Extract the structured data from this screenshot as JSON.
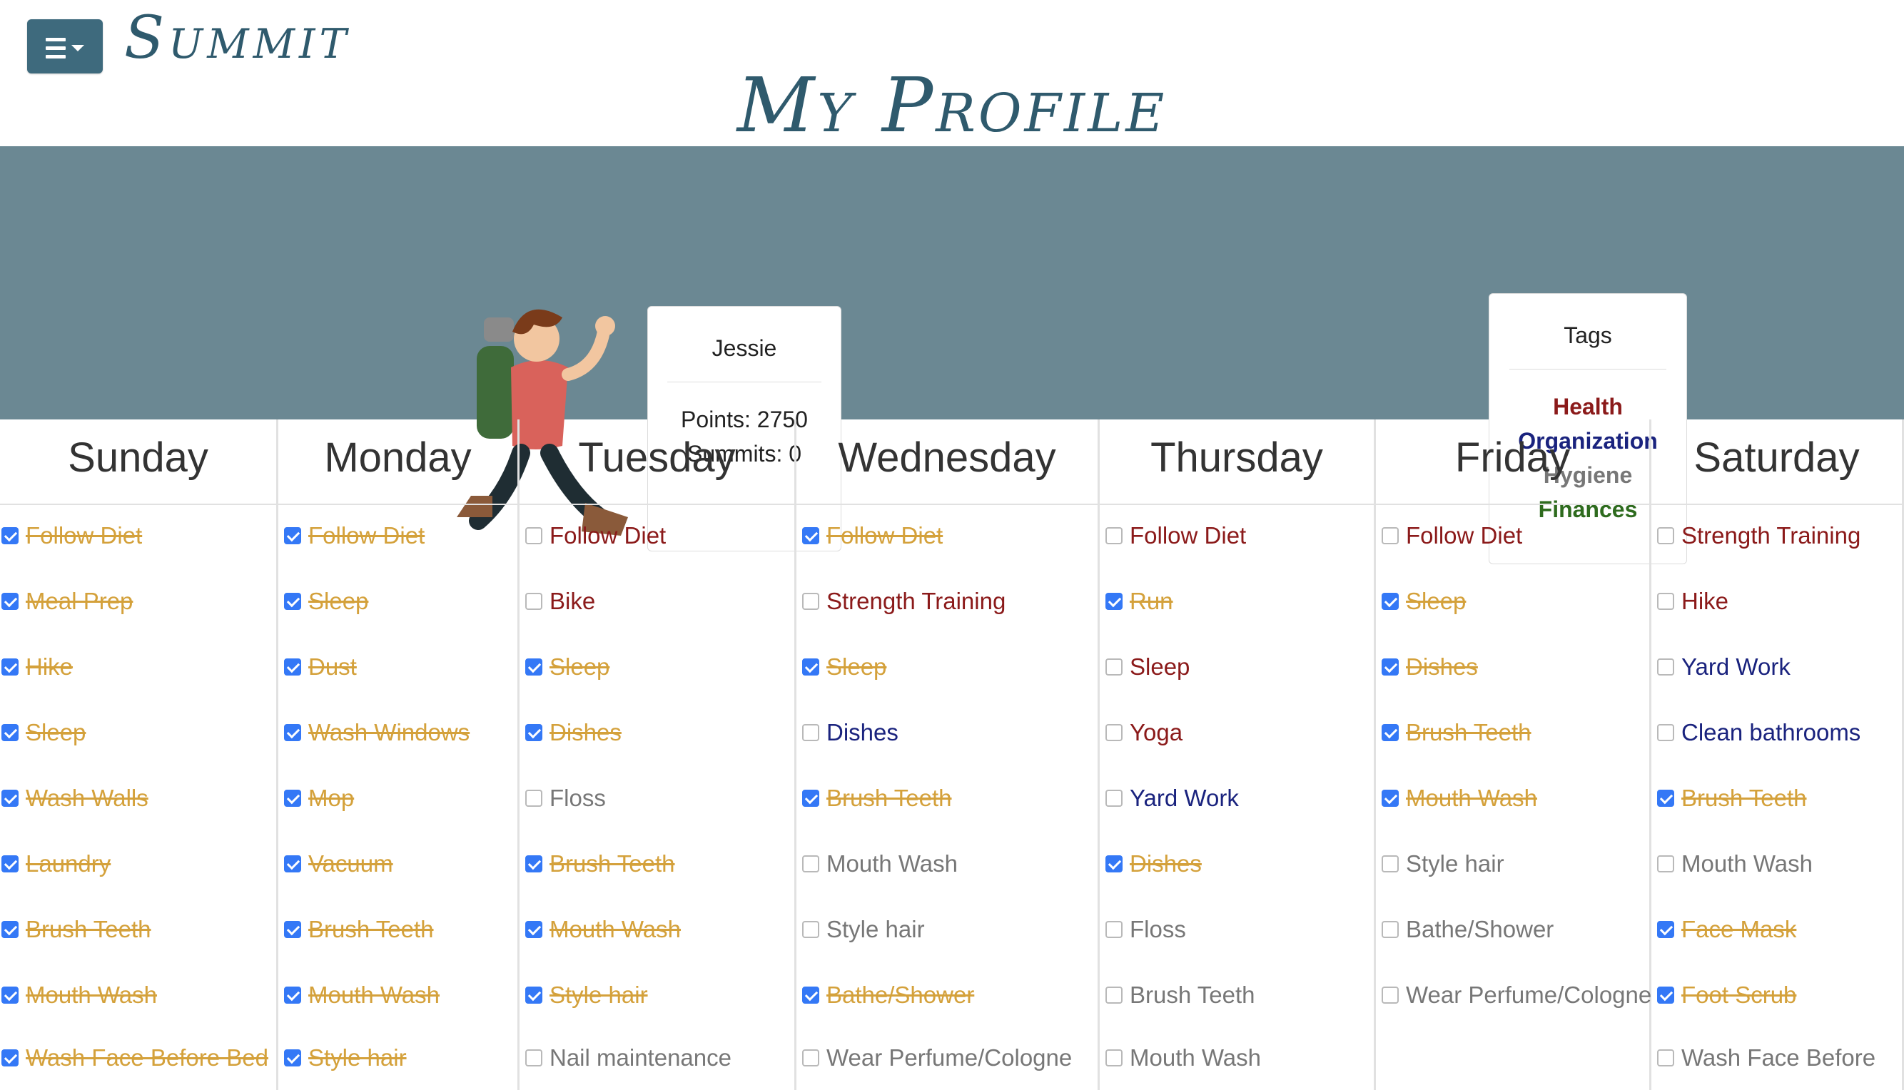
{
  "app": {
    "logo": "Summit",
    "page_title": "My Profile"
  },
  "profile": {
    "name": "Jessie",
    "points_text": "Points: 2750",
    "summits_text": "Summits: 0"
  },
  "tags": {
    "title": "Tags",
    "items": [
      {
        "label": "Health",
        "color": "#8b1a1a"
      },
      {
        "label": "Organization",
        "color": "#1a237e"
      },
      {
        "label": "Hygiene",
        "color": "#777777"
      },
      {
        "label": "Finances",
        "color": "#2e6b1e"
      }
    ]
  },
  "tag_colors": {
    "health": "#8b1a1a",
    "organization": "#1a237e",
    "hygiene": "#777777",
    "finances": "#2e6b1e",
    "done": "#d4a13b"
  },
  "days": [
    {
      "name": "Sunday",
      "tasks": [
        {
          "label": "Follow Diet",
          "done": true,
          "tag": "health"
        },
        {
          "label": "Meal Prep",
          "done": true,
          "tag": "health"
        },
        {
          "label": "Hike",
          "done": true,
          "tag": "health"
        },
        {
          "label": "Sleep",
          "done": true,
          "tag": "health"
        },
        {
          "label": "Wash Walls",
          "done": true,
          "tag": "organization"
        },
        {
          "label": "Laundry",
          "done": true,
          "tag": "organization"
        },
        {
          "label": "Brush Teeth",
          "done": true,
          "tag": "hygiene"
        },
        {
          "label": "Mouth Wash",
          "done": true,
          "tag": "hygiene"
        },
        {
          "label": "Wash Face Before Bed",
          "done": true,
          "tag": "hygiene"
        }
      ]
    },
    {
      "name": "Monday",
      "tasks": [
        {
          "label": "Follow Diet",
          "done": true,
          "tag": "health"
        },
        {
          "label": "Sleep",
          "done": true,
          "tag": "health"
        },
        {
          "label": "Dust",
          "done": true,
          "tag": "organization"
        },
        {
          "label": "Wash Windows",
          "done": true,
          "tag": "organization"
        },
        {
          "label": "Mop",
          "done": true,
          "tag": "organization"
        },
        {
          "label": "Vacuum",
          "done": true,
          "tag": "organization"
        },
        {
          "label": "Brush Teeth",
          "done": true,
          "tag": "hygiene"
        },
        {
          "label": "Mouth Wash",
          "done": true,
          "tag": "hygiene"
        },
        {
          "label": "Style hair",
          "done": true,
          "tag": "hygiene"
        }
      ]
    },
    {
      "name": "Tuesday",
      "tasks": [
        {
          "label": "Follow Diet",
          "done": false,
          "tag": "health"
        },
        {
          "label": "Bike",
          "done": false,
          "tag": "health"
        },
        {
          "label": "Sleep",
          "done": true,
          "tag": "health"
        },
        {
          "label": "Dishes",
          "done": true,
          "tag": "organization"
        },
        {
          "label": "Floss",
          "done": false,
          "tag": "hygiene"
        },
        {
          "label": "Brush Teeth",
          "done": true,
          "tag": "hygiene"
        },
        {
          "label": "Mouth Wash",
          "done": true,
          "tag": "hygiene"
        },
        {
          "label": "Style hair",
          "done": true,
          "tag": "hygiene"
        },
        {
          "label": "Nail maintenance",
          "done": false,
          "tag": "hygiene"
        }
      ]
    },
    {
      "name": "Wednesday",
      "tasks": [
        {
          "label": "Follow Diet",
          "done": true,
          "tag": "health"
        },
        {
          "label": "Strength Training",
          "done": false,
          "tag": "health"
        },
        {
          "label": "Sleep",
          "done": true,
          "tag": "health"
        },
        {
          "label": "Dishes",
          "done": false,
          "tag": "organization"
        },
        {
          "label": "Brush Teeth",
          "done": true,
          "tag": "hygiene"
        },
        {
          "label": "Mouth Wash",
          "done": false,
          "tag": "hygiene"
        },
        {
          "label": "Style hair",
          "done": false,
          "tag": "hygiene"
        },
        {
          "label": "Bathe/Shower",
          "done": true,
          "tag": "hygiene"
        },
        {
          "label": "Wear Perfume/Cologne",
          "done": false,
          "tag": "hygiene"
        }
      ]
    },
    {
      "name": "Thursday",
      "tasks": [
        {
          "label": "Follow Diet",
          "done": false,
          "tag": "health"
        },
        {
          "label": "Run",
          "done": true,
          "tag": "health"
        },
        {
          "label": "Sleep",
          "done": false,
          "tag": "health"
        },
        {
          "label": "Yoga",
          "done": false,
          "tag": "health"
        },
        {
          "label": "Yard Work",
          "done": false,
          "tag": "organization"
        },
        {
          "label": "Dishes",
          "done": true,
          "tag": "organization"
        },
        {
          "label": "Floss",
          "done": false,
          "tag": "hygiene"
        },
        {
          "label": "Brush Teeth",
          "done": false,
          "tag": "hygiene"
        },
        {
          "label": "Mouth Wash",
          "done": false,
          "tag": "hygiene"
        }
      ]
    },
    {
      "name": "Friday",
      "tasks": [
        {
          "label": "Follow Diet",
          "done": false,
          "tag": "health"
        },
        {
          "label": "Sleep",
          "done": true,
          "tag": "health"
        },
        {
          "label": "Dishes",
          "done": true,
          "tag": "organization"
        },
        {
          "label": "Brush Teeth",
          "done": true,
          "tag": "hygiene"
        },
        {
          "label": "Mouth Wash",
          "done": true,
          "tag": "hygiene"
        },
        {
          "label": "Style hair",
          "done": false,
          "tag": "hygiene"
        },
        {
          "label": "Bathe/Shower",
          "done": false,
          "tag": "hygiene"
        },
        {
          "label": "Wear Perfume/Cologne",
          "done": false,
          "tag": "hygiene"
        }
      ]
    },
    {
      "name": "Saturday",
      "tasks": [
        {
          "label": "Strength Training",
          "done": false,
          "tag": "health"
        },
        {
          "label": "Hike",
          "done": false,
          "tag": "health"
        },
        {
          "label": "Yard Work",
          "done": false,
          "tag": "organization"
        },
        {
          "label": "Clean bathrooms",
          "done": false,
          "tag": "organization"
        },
        {
          "label": "Brush Teeth",
          "done": true,
          "tag": "hygiene"
        },
        {
          "label": "Mouth Wash",
          "done": false,
          "tag": "hygiene"
        },
        {
          "label": "Face Mask",
          "done": true,
          "tag": "hygiene"
        },
        {
          "label": "Foot Scrub",
          "done": true,
          "tag": "hygiene"
        },
        {
          "label": "Wash Face Before",
          "done": false,
          "tag": "hygiene"
        }
      ]
    }
  ]
}
